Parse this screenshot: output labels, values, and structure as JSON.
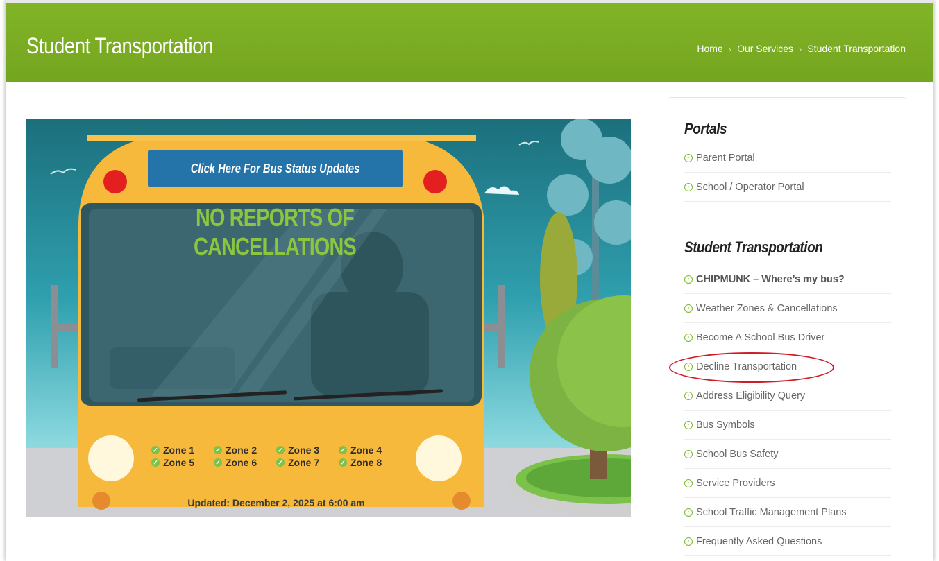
{
  "header": {
    "title": "Student Transportation",
    "breadcrumb": [
      {
        "label": "Home"
      },
      {
        "label": "Our Services"
      },
      {
        "label": "Student Transportation"
      }
    ],
    "separator": "›"
  },
  "hero": {
    "status_button_label": "Click Here For Bus Status Updates",
    "banner_text": "NO REPORTS OF CANCELLATIONS",
    "zones": [
      "Zone 1",
      "Zone 2",
      "Zone 3",
      "Zone 4",
      "Zone 5",
      "Zone 6",
      "Zone 7",
      "Zone 8"
    ],
    "updated_text": "Updated: December 2, 2025 at 6:00 am"
  },
  "sidebar": {
    "portals_title": "Portals",
    "portals": [
      "Parent Portal",
      "School / Operator Portal"
    ],
    "transport_title": "Student Transportation",
    "transport_items": [
      "CHIPMUNK – Where’s my bus?",
      "Weather Zones & Cancellations",
      "Become A School Bus Driver",
      "Decline Transportation",
      "Address Eligibility Query",
      "Bus Symbols",
      "School Bus Safety",
      "Service Providers",
      "School Traffic Management Plans",
      "Frequently Asked Questions"
    ]
  },
  "colors": {
    "header_green": "#7aab22",
    "bus_yellow": "#f6b93b",
    "button_blue": "#2574a9",
    "banner_green": "#8cc63f",
    "highlight_red": "#d01c24"
  }
}
